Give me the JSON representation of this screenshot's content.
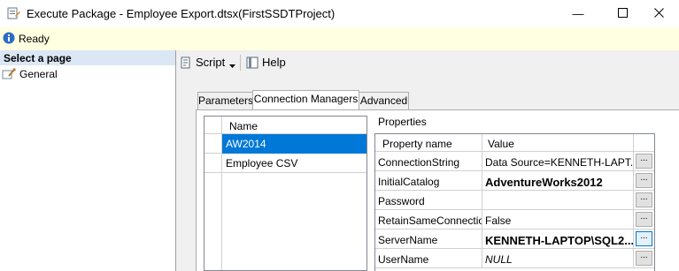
{
  "window": {
    "title": "Execute Package - Employee Export.dtsx(FirstSSDTProject)",
    "minimize_glyph": "—",
    "maximize_glyph": "☐",
    "close_glyph": "✕"
  },
  "status": {
    "text": "Ready"
  },
  "left_pane": {
    "header": "Select a page",
    "pages": [
      {
        "label": "General"
      }
    ]
  },
  "toolbar": {
    "script_label": "Script",
    "help_label": "Help"
  },
  "tabs": [
    {
      "label": "Parameters",
      "active": false
    },
    {
      "label": "Connection Managers",
      "active": true
    },
    {
      "label": "Advanced",
      "active": false
    }
  ],
  "connections": {
    "column_header": "Name",
    "rows": [
      {
        "name": "AW2014",
        "selected": true
      },
      {
        "name": "Employee CSV",
        "selected": false
      }
    ]
  },
  "properties": {
    "label": "Properties",
    "col_name": "Property name",
    "col_value": "Value",
    "button_label": "...",
    "rows": [
      {
        "name": "ConnectionString",
        "value": "Data Source=KENNETH-LAPT...",
        "style": "normal"
      },
      {
        "name": "InitialCatalog",
        "value": "AdventureWorks2012",
        "style": "bold"
      },
      {
        "name": "Password",
        "value": "",
        "style": "normal"
      },
      {
        "name": "RetainSameConnection",
        "value": "False",
        "style": "normal"
      },
      {
        "name": "ServerName",
        "value": "KENNETH-LAPTOP\\SQL2...",
        "style": "bold"
      },
      {
        "name": "UserName",
        "value": "NULL",
        "style": "italic"
      }
    ]
  },
  "colors": {
    "selection": "#0078d7",
    "status_bg": "#ffffe1",
    "select_page_bg": "#dbe7f5"
  }
}
